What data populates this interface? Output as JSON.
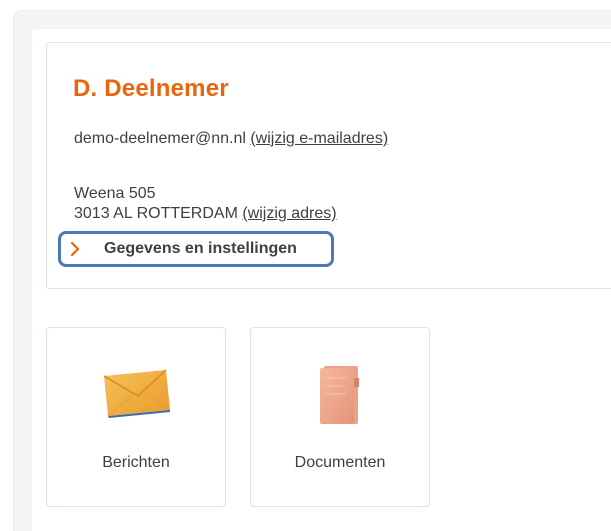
{
  "profile": {
    "name": "D. Deelnemer",
    "email": "demo-deelnemer@nn.nl",
    "email_change_link": "(wijzig e-mailadres)",
    "address_street": "Weena 505",
    "address_city": "3013 AL ROTTERDAM",
    "address_change_link": "(wijzig adres)",
    "settings_link": "Gegevens en instellingen",
    "settings_icon": "chevron-right-icon"
  },
  "tiles": [
    {
      "label": "Berichten",
      "icon": "envelope-icon"
    },
    {
      "label": "Documenten",
      "icon": "document-folder-icon"
    }
  ],
  "colors": {
    "brand_orange": "#ea650d",
    "highlight_blue": "#4a7ab7",
    "text": "#404040",
    "card_border": "#f0ddd2",
    "panel_bg": "#f4f4f4"
  }
}
